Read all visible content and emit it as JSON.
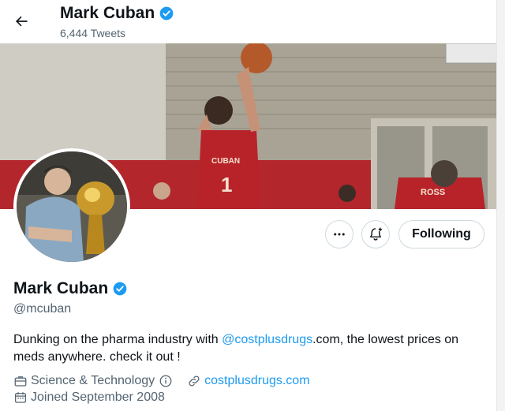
{
  "header": {
    "name": "Mark Cuban",
    "tweet_count": "6,444 Tweets"
  },
  "banner": {
    "jersey_front": "CUBAN",
    "jersey_number": "1",
    "jersey_back": "ROSS"
  },
  "profile": {
    "name": "Mark Cuban",
    "handle": "@mcuban",
    "bio_part1": "Dunking on the pharma industry with ",
    "bio_link": "@costplusdrugs",
    "bio_part2": ".com, the lowest prices on meds anywhere.  check it out !",
    "category": "Science & Technology",
    "website": "costplusdrugs.com",
    "joined": "Joined September 2008"
  },
  "actions": {
    "follow_label": "Following"
  },
  "colors": {
    "accent": "#1d9bf0",
    "verified": "#1d9bf0",
    "secondary_text": "#536471",
    "jersey_red": "#b8232a"
  },
  "icons": {
    "back": "arrow-left-icon",
    "verified": "verified-badge-icon",
    "more": "more-dots-icon",
    "notify": "bell-plus-icon",
    "category": "briefcase-icon",
    "info": "info-icon",
    "link": "link-icon",
    "calendar": "calendar-icon"
  }
}
